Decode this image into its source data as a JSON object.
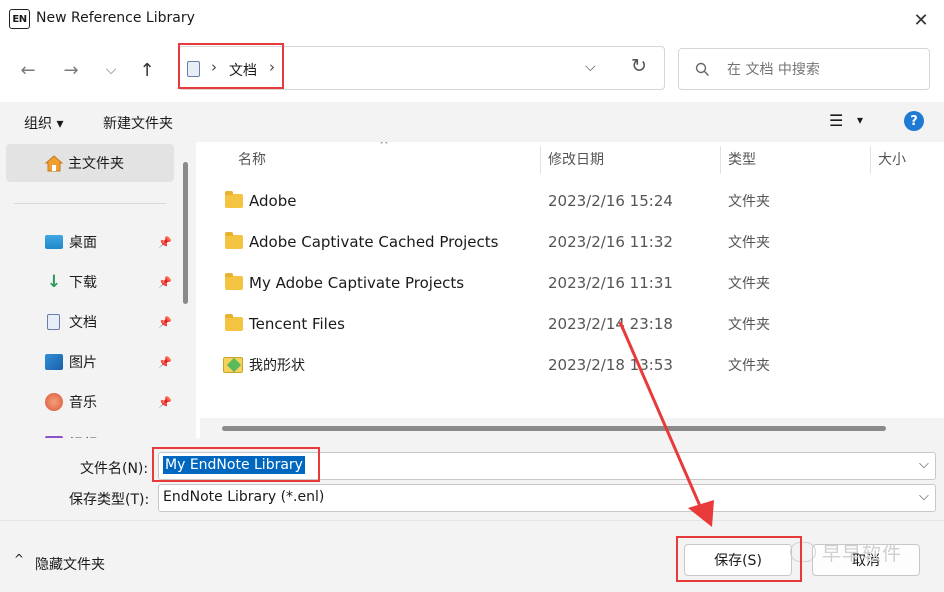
{
  "window": {
    "title": "New Reference Library",
    "app_icon_text": "EN",
    "close_glyph": "✕"
  },
  "nav": {
    "back": "←",
    "forward": "→",
    "recent": "⌵",
    "up": "↑",
    "refresh": "↻"
  },
  "address": {
    "separator1": "›",
    "folder": "文档",
    "separator2": "›",
    "dropdown": "⌵"
  },
  "search": {
    "placeholder": "在 文档 中搜索"
  },
  "command_bar": {
    "organize": "组织 ▾",
    "new_folder": "新建文件夹",
    "view": "☰",
    "view_dropdown": "▾",
    "help": "?"
  },
  "sidebar": {
    "home": "主文件夹",
    "items": [
      {
        "label": "桌面",
        "pin": "📌"
      },
      {
        "label": "下载",
        "pin": "📌"
      },
      {
        "label": "文档",
        "pin": "📌"
      },
      {
        "label": "图片",
        "pin": "📌"
      },
      {
        "label": "音乐",
        "pin": "📌"
      },
      {
        "label": "视频",
        "pin": ""
      }
    ]
  },
  "columns": {
    "name": "名称",
    "date": "修改日期",
    "type": "类型",
    "size": "大小",
    "sort_indicator": "^"
  },
  "files": [
    {
      "name": "Adobe",
      "date": "2023/2/16 15:24",
      "type": "文件夹"
    },
    {
      "name": "Adobe Captivate Cached Projects",
      "date": "2023/2/16 11:32",
      "type": "文件夹"
    },
    {
      "name": "My Adobe Captivate Projects",
      "date": "2023/2/16 11:31",
      "type": "文件夹"
    },
    {
      "name": "Tencent Files",
      "date": "2023/2/14 23:18",
      "type": "文件夹"
    },
    {
      "name": "我的形状",
      "date": "2023/2/18 13:53",
      "type": "文件夹"
    }
  ],
  "form": {
    "filename_label": "文件名(N):",
    "filename_value": "My EndNote Library",
    "filetype_label": "保存类型(T):",
    "filetype_value": "EndNote Library (*.enl)",
    "dropdown": "⌵"
  },
  "footer": {
    "hide_folders": "隐藏文件夹",
    "caret": "^",
    "save": "保存(S)",
    "cancel": "取消"
  },
  "watermark": {
    "text": "早早软件"
  },
  "colors": {
    "accent": "#0067c0",
    "highlight": "#e83a3a",
    "help": "#1f7ad6"
  }
}
